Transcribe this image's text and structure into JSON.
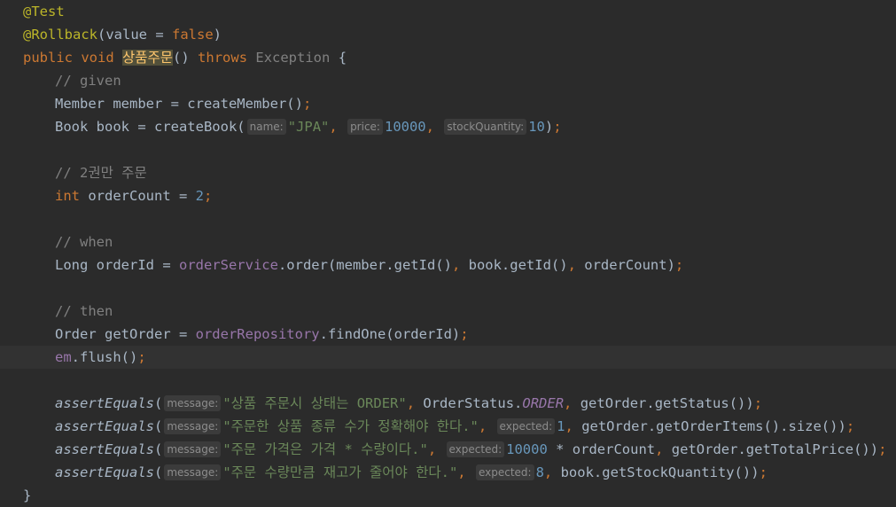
{
  "editor": {
    "lines": [
      {
        "segs": [
          {
            "t": "@Test",
            "c": "ann"
          }
        ]
      },
      {
        "segs": [
          {
            "t": "@Rollback",
            "c": "ann"
          },
          {
            "t": "(value = ",
            "c": "def"
          },
          {
            "t": "false",
            "c": "kw"
          },
          {
            "t": ")",
            "c": "def"
          }
        ]
      },
      {
        "segs": [
          {
            "t": "public void ",
            "c": "kw"
          },
          {
            "t": "상품주문",
            "c": "hl"
          },
          {
            "t": "() ",
            "c": "def"
          },
          {
            "t": "throws ",
            "c": "kw"
          },
          {
            "t": "Exception",
            "c": "ex"
          },
          {
            "t": " {",
            "c": "def"
          }
        ]
      },
      {
        "segs": [
          {
            "t": "// given",
            "c": "comment"
          }
        ]
      },
      {
        "segs": [
          {
            "t": "Member member = createMember()",
            "c": "def"
          },
          {
            "t": ";",
            "c": "kw"
          }
        ]
      },
      {
        "segs": [
          {
            "t": "Book book = createBook(",
            "c": "def"
          },
          {
            "t": "name:",
            "c": "hint"
          },
          {
            "t": "\"JPA\"",
            "c": "str"
          },
          {
            "t": ", ",
            "c": "kw"
          },
          {
            "t": "price:",
            "c": "hint"
          },
          {
            "t": "10000",
            "c": "num"
          },
          {
            "t": ", ",
            "c": "kw"
          },
          {
            "t": "stockQuantity:",
            "c": "hint"
          },
          {
            "t": "10",
            "c": "num"
          },
          {
            "t": ")",
            "c": "def"
          },
          {
            "t": ";",
            "c": "kw"
          }
        ]
      },
      {
        "segs": []
      },
      {
        "segs": [
          {
            "t": "// 2권만 주문",
            "c": "comment"
          }
        ]
      },
      {
        "segs": [
          {
            "t": "int ",
            "c": "kw"
          },
          {
            "t": "orderCount = ",
            "c": "def"
          },
          {
            "t": "2",
            "c": "num"
          },
          {
            "t": ";",
            "c": "kw"
          }
        ]
      },
      {
        "segs": []
      },
      {
        "segs": [
          {
            "t": "// when",
            "c": "comment"
          }
        ]
      },
      {
        "segs": [
          {
            "t": "Long orderId = ",
            "c": "def"
          },
          {
            "t": "orderService",
            "c": "field"
          },
          {
            "t": ".order(member.getId()",
            "c": "def"
          },
          {
            "t": ", ",
            "c": "kw"
          },
          {
            "t": "book.getId()",
            "c": "def"
          },
          {
            "t": ", ",
            "c": "kw"
          },
          {
            "t": "orderCount)",
            "c": "def"
          },
          {
            "t": ";",
            "c": "kw"
          }
        ]
      },
      {
        "segs": []
      },
      {
        "segs": [
          {
            "t": "// then",
            "c": "comment"
          }
        ]
      },
      {
        "segs": [
          {
            "t": "Order getOrder = ",
            "c": "def"
          },
          {
            "t": "orderRepository",
            "c": "field"
          },
          {
            "t": ".findOne(orderId)",
            "c": "def"
          },
          {
            "t": ";",
            "c": "kw"
          }
        ]
      },
      {
        "segs": [
          {
            "t": "em",
            "c": "field"
          },
          {
            "t": ".flush()",
            "c": "def"
          },
          {
            "t": ";",
            "c": "kw"
          }
        ]
      },
      {
        "segs": []
      },
      {
        "segs": [
          {
            "t": "assertEquals",
            "c": "fn-ital"
          },
          {
            "t": "(",
            "c": "def"
          },
          {
            "t": "message:",
            "c": "hint"
          },
          {
            "t": "\"상품 주문시 상태는 ORDER\"",
            "c": "str"
          },
          {
            "t": ", ",
            "c": "kw"
          },
          {
            "t": "OrderStatus.",
            "c": "def"
          },
          {
            "t": "ORDER",
            "c": "static-ital"
          },
          {
            "t": ", ",
            "c": "kw"
          },
          {
            "t": "getOrder.getStatus())",
            "c": "def"
          },
          {
            "t": ";",
            "c": "kw"
          }
        ]
      },
      {
        "segs": [
          {
            "t": "assertEquals",
            "c": "fn-ital"
          },
          {
            "t": "(",
            "c": "def"
          },
          {
            "t": "message:",
            "c": "hint"
          },
          {
            "t": "\"주문한 상품 종류 수가 정확해야 한다.\"",
            "c": "str"
          },
          {
            "t": ", ",
            "c": "kw"
          },
          {
            "t": "expected:",
            "c": "hint"
          },
          {
            "t": "1",
            "c": "num"
          },
          {
            "t": ", ",
            "c": "kw"
          },
          {
            "t": "getOrder.getOrderItems().size())",
            "c": "def"
          },
          {
            "t": ";",
            "c": "kw"
          }
        ]
      },
      {
        "segs": [
          {
            "t": "assertEquals",
            "c": "fn-ital"
          },
          {
            "t": "(",
            "c": "def"
          },
          {
            "t": "message:",
            "c": "hint"
          },
          {
            "t": "\"주문 가격은 가격 * 수량이다.\"",
            "c": "str"
          },
          {
            "t": ", ",
            "c": "kw"
          },
          {
            "t": "expected:",
            "c": "hint"
          },
          {
            "t": "10000",
            "c": "num"
          },
          {
            "t": " * orderCount",
            "c": "def"
          },
          {
            "t": ", ",
            "c": "kw"
          },
          {
            "t": "getOrder.getTotalPrice())",
            "c": "def"
          },
          {
            "t": ";",
            "c": "kw"
          }
        ]
      },
      {
        "segs": [
          {
            "t": "assertEquals",
            "c": "fn-ital"
          },
          {
            "t": "(",
            "c": "def"
          },
          {
            "t": "message:",
            "c": "hint"
          },
          {
            "t": "\"주문 수량만큼 재고가 줄어야 한다.\"",
            "c": "str"
          },
          {
            "t": ", ",
            "c": "kw"
          },
          {
            "t": "expected:",
            "c": "hint"
          },
          {
            "t": "8",
            "c": "num"
          },
          {
            "t": ", ",
            "c": "kw"
          },
          {
            "t": "book.getStockQuantity())",
            "c": "def"
          },
          {
            "t": ";",
            "c": "kw"
          }
        ]
      },
      {
        "segs": [
          {
            "t": "}",
            "c": "def"
          }
        ]
      }
    ]
  },
  "colors": {
    "background": "#2b2b2b",
    "current_line": "#323232",
    "keyword": "#cc7832",
    "annotation": "#bbb529",
    "string": "#6a8759",
    "number": "#6897bb",
    "field": "#9876aa",
    "comment": "#808080",
    "method_highlight": "#ffc66d"
  }
}
